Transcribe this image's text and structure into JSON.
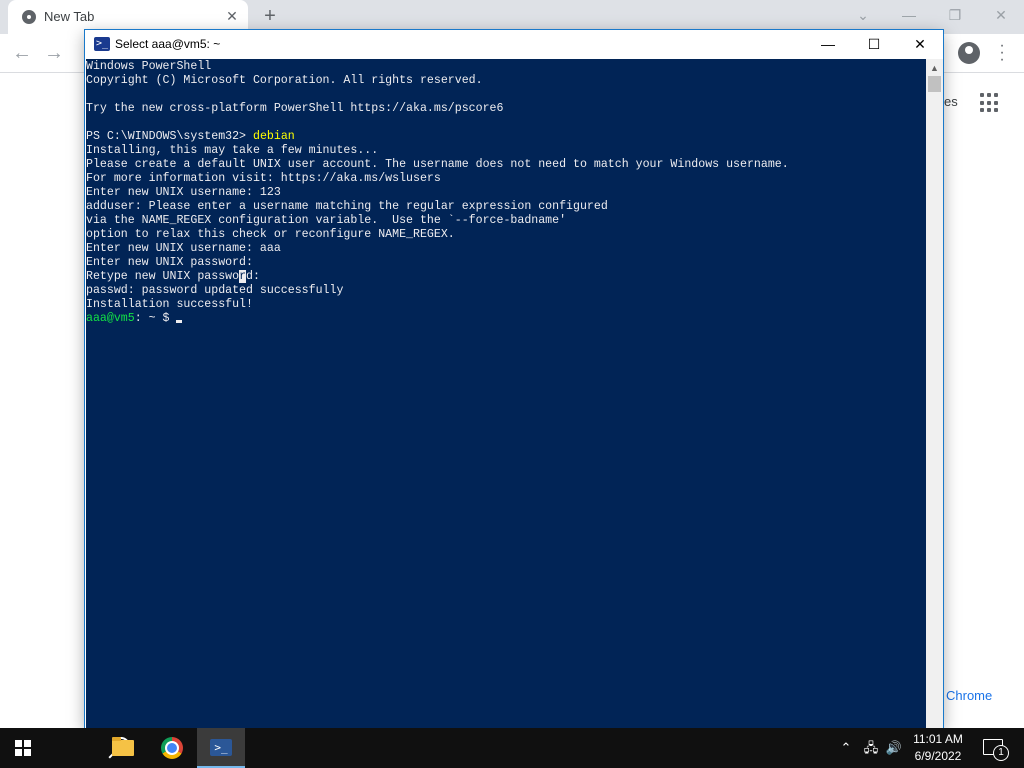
{
  "chrome": {
    "tab_title": "New Tab",
    "tab_close": "✕",
    "new_tab": "+",
    "images_link": "es",
    "customize_link": "Chrome"
  },
  "console": {
    "title": "Select aaa@vm5: ~",
    "lines": [
      {
        "text": "Windows PowerShell"
      },
      {
        "text": "Copyright (C) Microsoft Corporation. All rights reserved."
      },
      {
        "text": ""
      },
      {
        "text": "Try the new cross-platform PowerShell https://aka.ms/pscore6"
      },
      {
        "text": ""
      },
      {
        "prompt": "PS C:\\WINDOWS\\system32> ",
        "command": "debian"
      },
      {
        "text": "Installing, this may take a few minutes..."
      },
      {
        "text": "Please create a default UNIX user account. The username does not need to match your Windows username."
      },
      {
        "text": "For more information visit: https://aka.ms/wslusers"
      },
      {
        "text": "Enter new UNIX username: 123"
      },
      {
        "text": "adduser: Please enter a username matching the regular expression configured"
      },
      {
        "text": "via the NAME_REGEX configuration variable.  Use the `--force-badname'"
      },
      {
        "text": "option to relax this check or reconfigure NAME_REGEX."
      },
      {
        "text": "Enter new UNIX username: aaa"
      },
      {
        "text": "Enter new UNIX password:"
      },
      {
        "pre": "Retype new UNIX passwo",
        "selected": "r",
        "post": "d:"
      },
      {
        "text": "passwd: password updated successfully"
      },
      {
        "text": "Installation successful!"
      }
    ],
    "shell_prompt_user": "aaa@vm5",
    "shell_prompt_rest": ": ~ $ "
  },
  "taskbar": {
    "time": "11:01 AM",
    "date": "6/9/2022",
    "notification_count": "1"
  }
}
